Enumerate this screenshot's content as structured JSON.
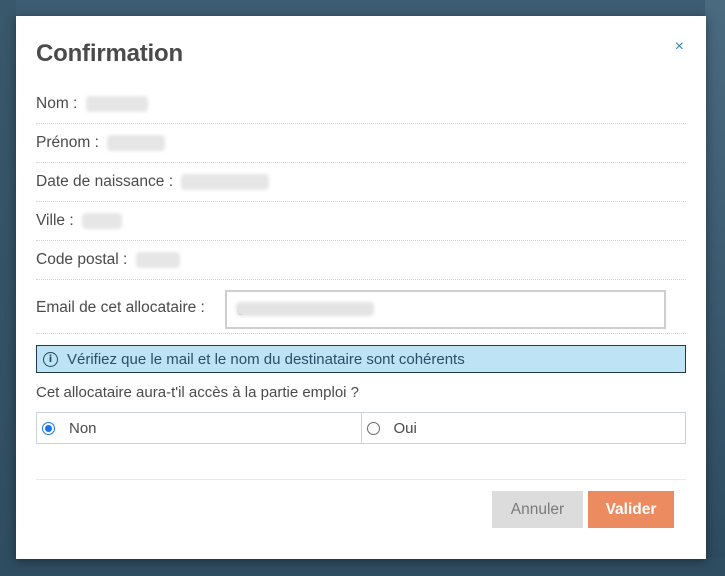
{
  "dialog": {
    "title": "Confirmation",
    "close_symbol": "×"
  },
  "fields": [
    {
      "label": "Nom :"
    },
    {
      "label": "Prénom :"
    },
    {
      "label": "Date de naissance :"
    },
    {
      "label": "Ville :"
    },
    {
      "label": "Code postal :"
    }
  ],
  "email": {
    "label": "Email de cet allocataire :",
    "value": "c"
  },
  "info": {
    "icon": "info-circle-icon",
    "icon_glyph": "i",
    "message": "Vérifiez que le mail et le nom du destinataire sont cohérents"
  },
  "question": {
    "text": "Cet allocataire aura-t'il accès à la partie emploi ?",
    "options": [
      "Non",
      "Oui"
    ],
    "selected": "Non"
  },
  "buttons": {
    "cancel": "Annuler",
    "submit": "Valider"
  },
  "colors": {
    "accent": "#ec8b60",
    "info_bg": "#bde3f5",
    "radio": "#1a73e8"
  }
}
